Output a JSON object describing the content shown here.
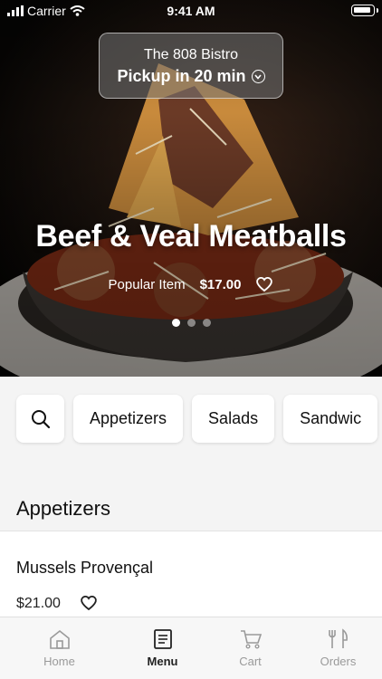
{
  "status_bar": {
    "carrier": "Carrier",
    "time": "9:41 AM"
  },
  "hero": {
    "restaurant": "The 808 Bistro",
    "pickup": "Pickup in 20 min",
    "title": "Beef & Veal Meatballs",
    "tag": "Popular Item",
    "price": "$17.00",
    "page_count": 3,
    "active_page": 1
  },
  "chips": [
    {
      "label": "Appetizers"
    },
    {
      "label": "Salads"
    },
    {
      "label": "Sandwic"
    }
  ],
  "section": {
    "title": "Appetizers"
  },
  "items": [
    {
      "name": "Mussels Provençal",
      "price": "$21.00"
    }
  ],
  "tabs": [
    {
      "label": "Home",
      "icon": "home-icon"
    },
    {
      "label": "Menu",
      "icon": "menu-icon"
    },
    {
      "label": "Cart",
      "icon": "cart-icon"
    },
    {
      "label": "Orders",
      "icon": "orders-icon"
    }
  ],
  "colors": {
    "active_tab": "#222222",
    "inactive_tab": "#9a9a9a"
  }
}
